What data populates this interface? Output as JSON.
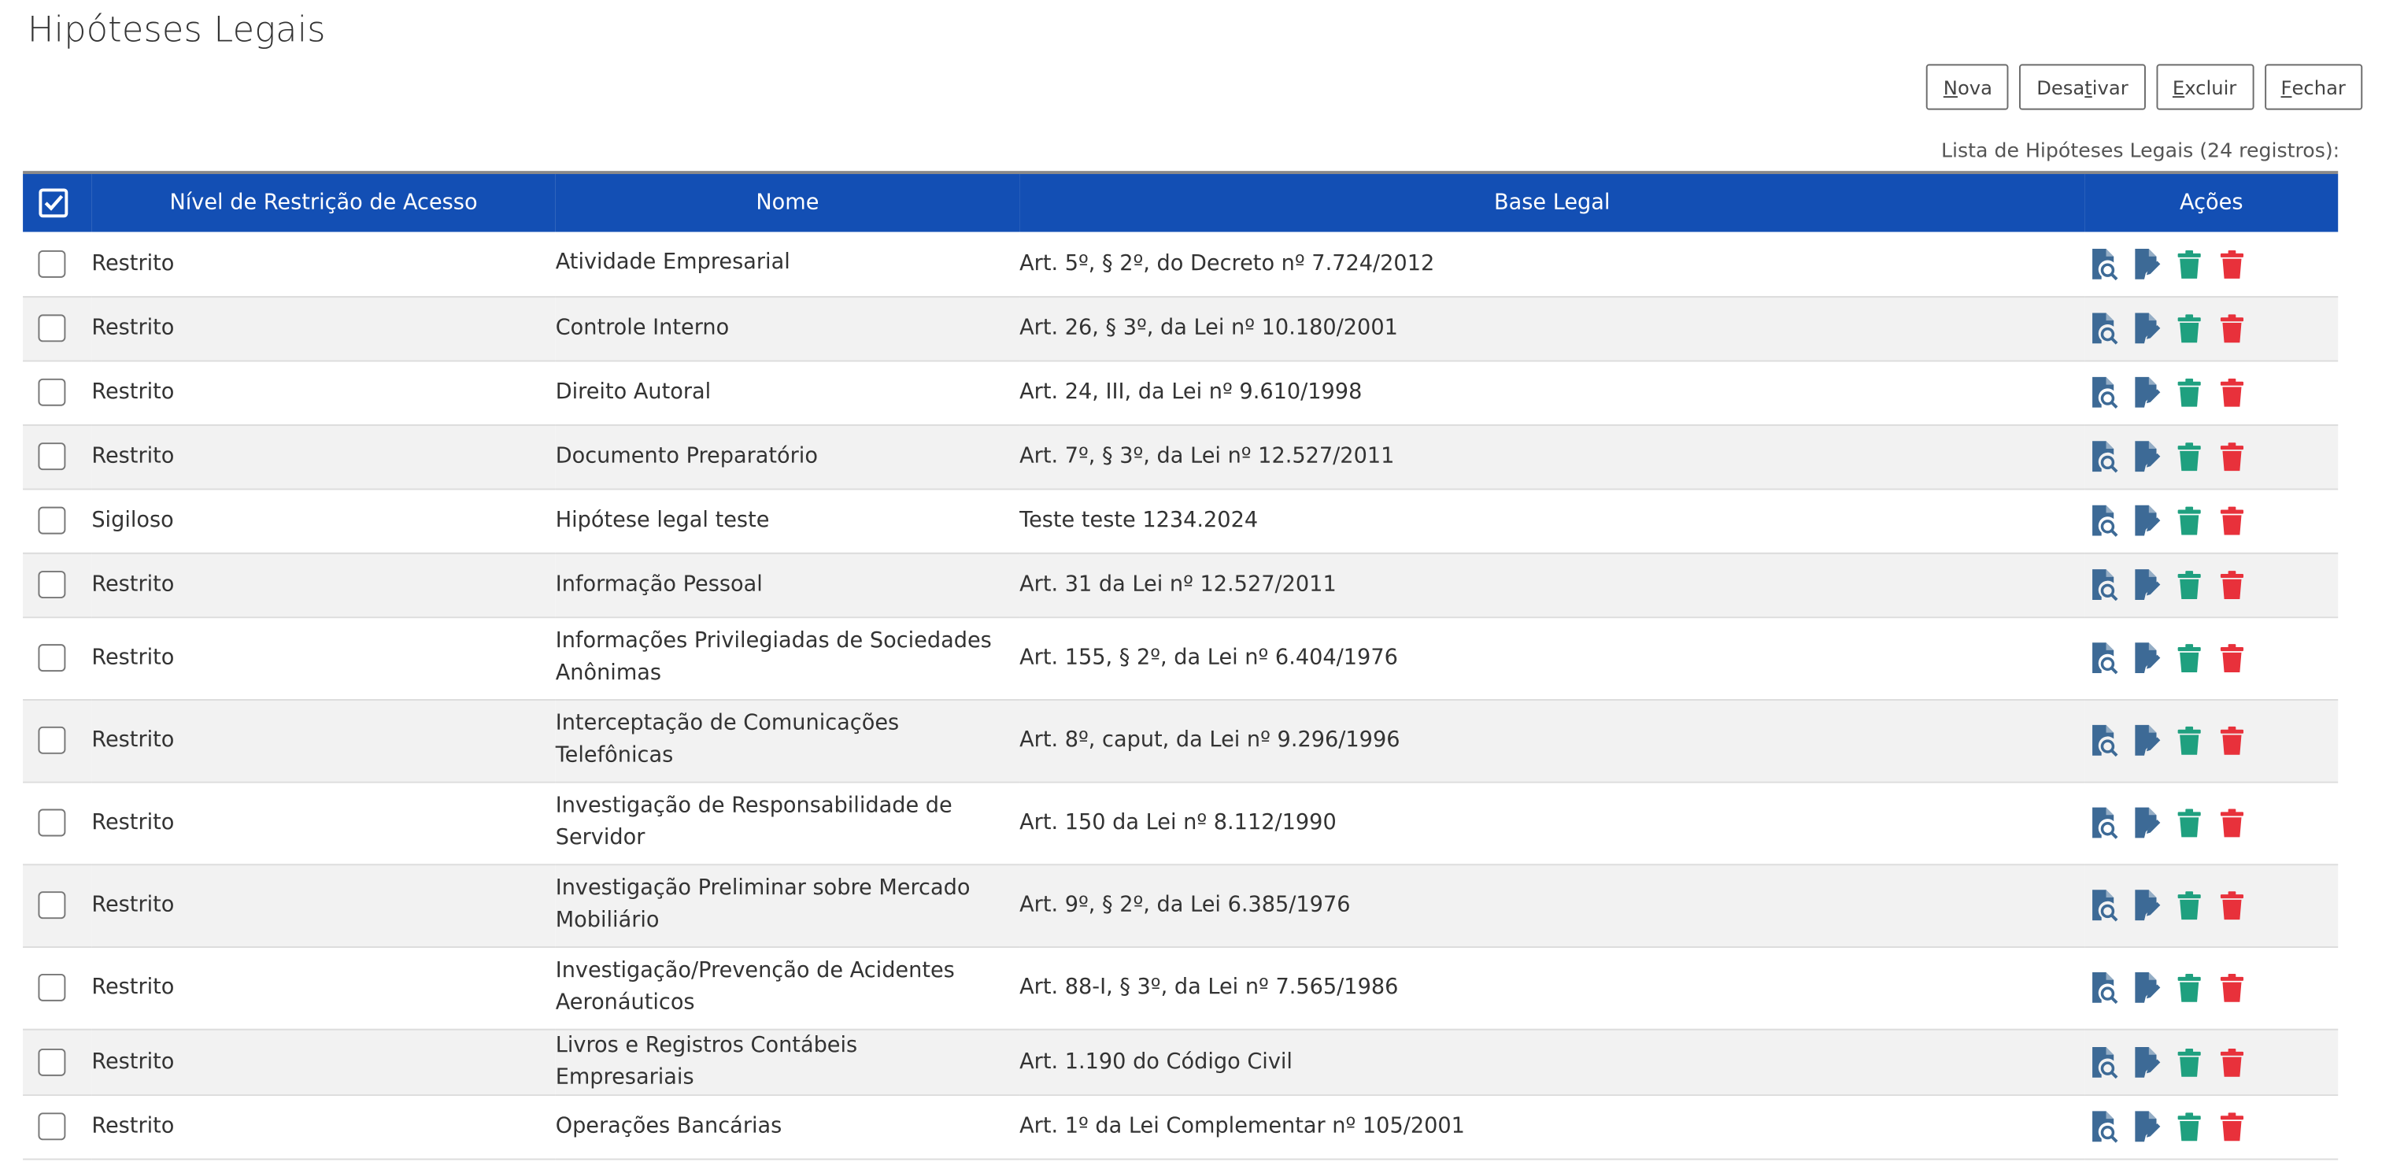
{
  "page": {
    "title": "Hipóteses Legais"
  },
  "toolbar": {
    "nova_first": "N",
    "nova_rest": "ova",
    "desativar_first": "Desa",
    "desativar_acc": "t",
    "desativar_rest": "ivar",
    "excluir_first": "",
    "excluir_acc": "E",
    "excluir_rest": "xcluir",
    "fechar_acc": "F",
    "fechar_rest": "echar"
  },
  "table": {
    "caption": "Lista de Hipóteses Legais (24 registros):",
    "headers": {
      "nivel": "Nível de Restrição de Acesso",
      "nome": "Nome",
      "base": "Base Legal",
      "acoes": "Ações"
    },
    "rows": [
      {
        "nivel": "Restrito",
        "nome": "Atividade Empresarial",
        "base": "Art. 5º, § 2º, do Decreto nº 7.724/2012"
      },
      {
        "nivel": "Restrito",
        "nome": "Controle Interno",
        "base": "Art. 26, § 3º, da Lei nº 10.180/2001"
      },
      {
        "nivel": "Restrito",
        "nome": "Direito Autoral",
        "base": "Art. 24, III, da Lei nº 9.610/1998"
      },
      {
        "nivel": "Restrito",
        "nome": "Documento Preparatório",
        "base": "Art. 7º, § 3º, da Lei nº 12.527/2011"
      },
      {
        "nivel": "Sigiloso",
        "nome": "Hipótese legal teste",
        "base": "Teste teste 1234.2024"
      },
      {
        "nivel": "Restrito",
        "nome": "Informação Pessoal",
        "base": "Art. 31 da Lei nº 12.527/2011"
      },
      {
        "nivel": "Restrito",
        "nome": "Informações Privilegiadas de Sociedades Anônimas",
        "base": "Art. 155, § 2º, da Lei nº 6.404/1976"
      },
      {
        "nivel": "Restrito",
        "nome": "Interceptação de Comunicações Telefônicas",
        "base": "Art. 8º, caput, da Lei nº 9.296/1996"
      },
      {
        "nivel": "Restrito",
        "nome": "Investigação de Responsabilidade de Servidor",
        "base": "Art. 150 da Lei nº 8.112/1990"
      },
      {
        "nivel": "Restrito",
        "nome": "Investigação Preliminar sobre Mercado Mobiliário",
        "base": "Art. 9º, § 2º, da Lei 6.385/1976"
      },
      {
        "nivel": "Restrito",
        "nome": "Investigação/Prevenção de Acidentes Aeronáuticos",
        "base": "Art. 88-I, § 3º, da Lei nº 7.565/1986"
      },
      {
        "nivel": "Restrito",
        "nome": "Livros e Registros Contábeis Empresariais",
        "base": "Art. 1.190 do Código Civil"
      },
      {
        "nivel": "Restrito",
        "nome": "Operações Bancárias",
        "base": "Art. 1º da Lei Complementar nº 105/2001"
      }
    ]
  },
  "icons": {
    "consultar": "view-document-icon",
    "alterar": "edit-document-icon",
    "desativar": "deactivate-trash-icon",
    "excluir": "delete-trash-icon",
    "select_all": "checkbox-checked-icon"
  },
  "colors": {
    "header_bg": "#134fb4",
    "view_icon": "#3d6a96",
    "edit_icon": "#3d6a96",
    "deactivate_icon": "#1fa07f",
    "delete_icon": "#e8313b"
  }
}
